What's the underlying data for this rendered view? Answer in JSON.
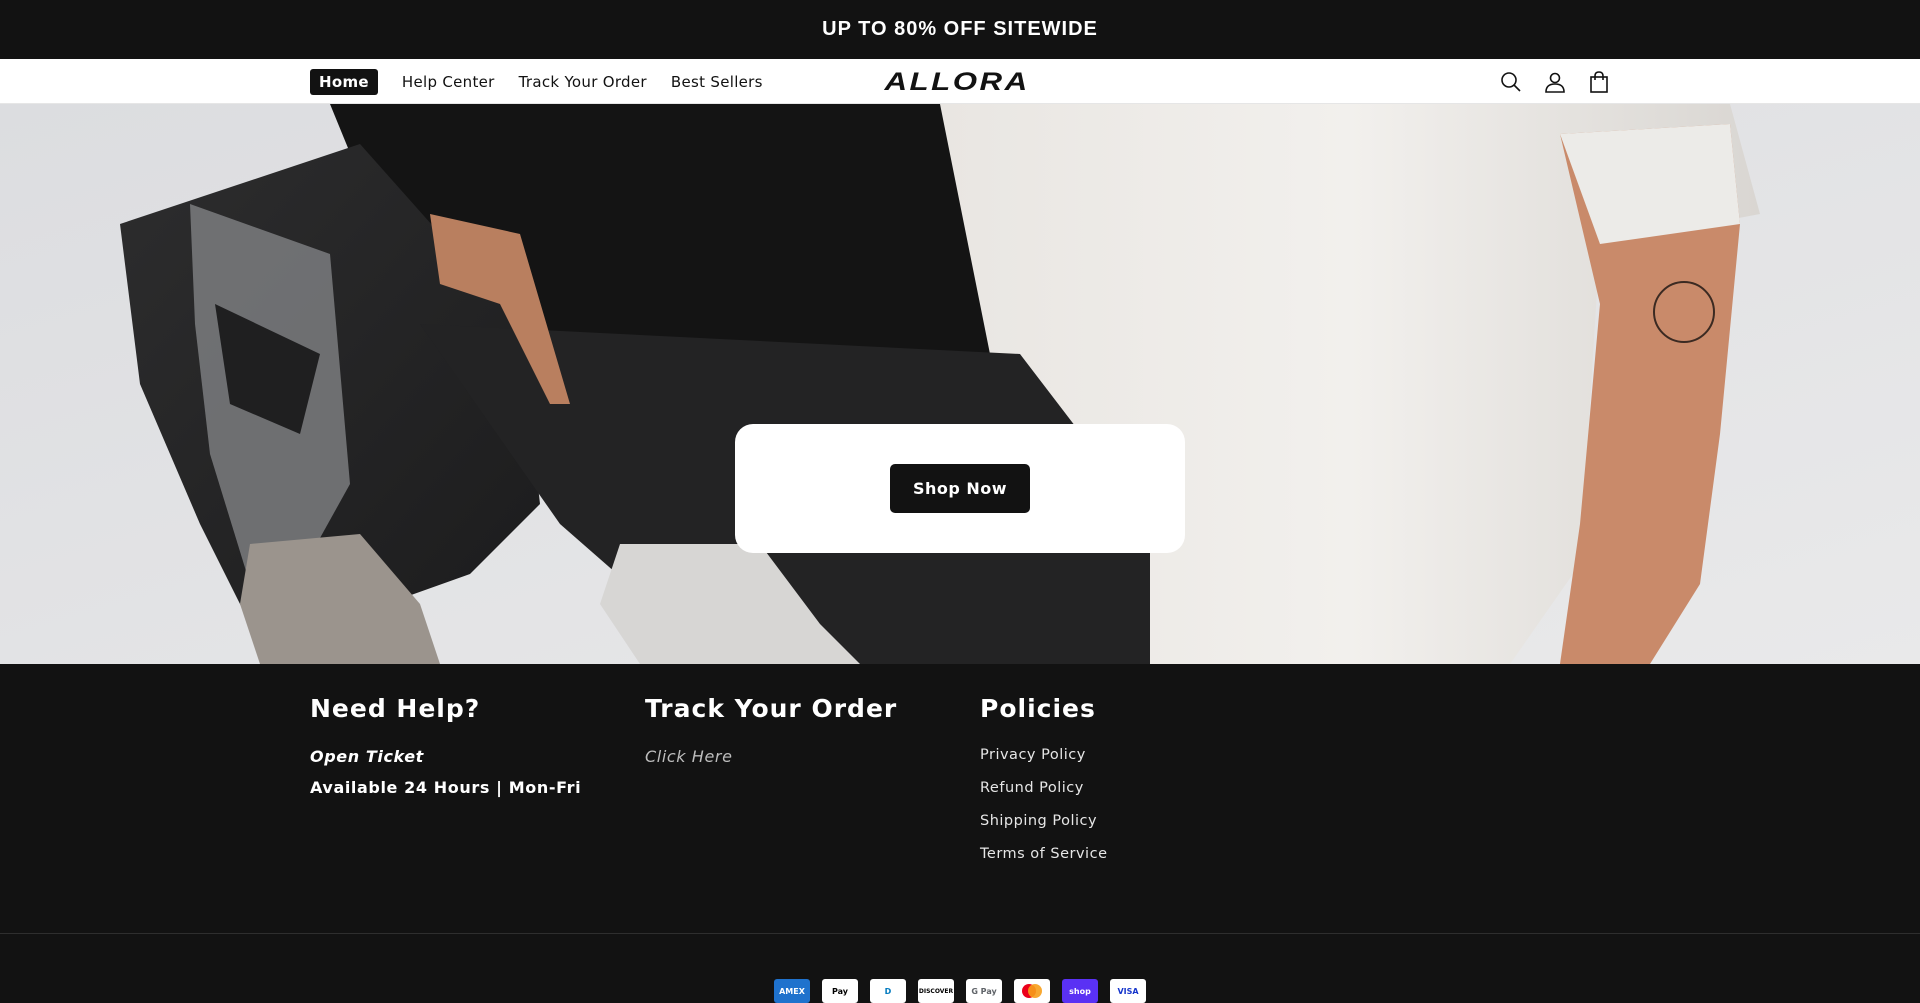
{
  "announcement": {
    "text": "UP TO 80% OFF SITEWIDE"
  },
  "nav": {
    "items": [
      {
        "label": "Home",
        "active": true
      },
      {
        "label": "Help Center"
      },
      {
        "label": "Track Your Order"
      },
      {
        "label": "Best Sellers"
      }
    ]
  },
  "logo": {
    "text": "ALLORA"
  },
  "header_icons": [
    "search-icon",
    "account-icon",
    "cart-icon"
  ],
  "hero": {
    "button_label": "Shop Now"
  },
  "footer": {
    "help": {
      "heading": "Need Help?",
      "ticket": "Open Ticket",
      "availability": "Available 24 Hours | Mon-Fri"
    },
    "track": {
      "heading": "Track Your Order",
      "link": "Click Here"
    },
    "policies": {
      "heading": "Policies",
      "links": [
        "Privacy Policy",
        "Refund Policy",
        "Shipping Policy",
        "Terms of Service"
      ]
    },
    "payment_methods": [
      {
        "label": "AMEX",
        "color": "#1f72cd"
      },
      {
        "label": "Pay",
        "color": "#ffffff"
      },
      {
        "label": "D",
        "color": "#ffffff"
      },
      {
        "label": "DISCOVER",
        "color": "#ffffff"
      },
      {
        "label": "G Pay",
        "color": "#ffffff"
      },
      {
        "label": "",
        "color": "#ffffff"
      },
      {
        "label": "shop",
        "color": "#5a31f4"
      },
      {
        "label": "VISA",
        "color": "#ffffff"
      }
    ]
  }
}
